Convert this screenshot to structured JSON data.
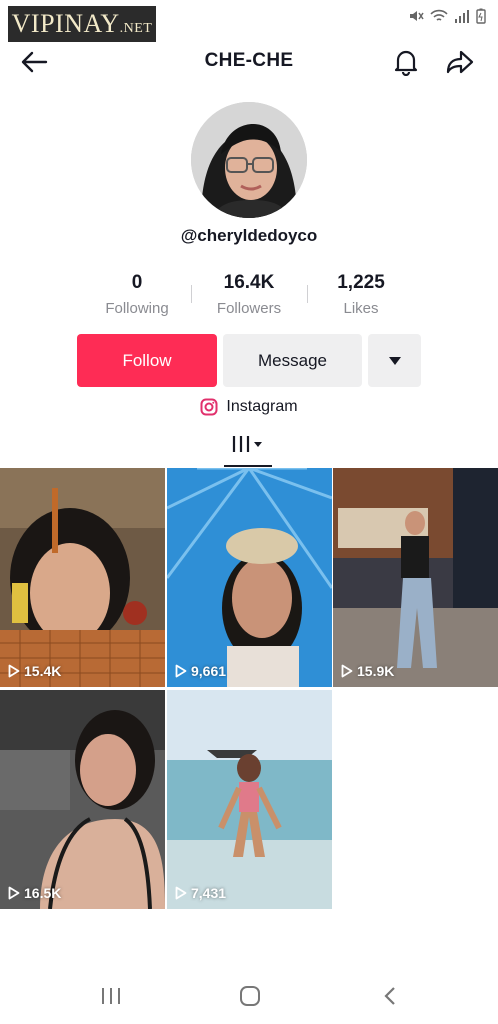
{
  "watermark": {
    "main": "VIPINAY",
    "suffix": ".NET"
  },
  "header": {
    "title": "CHE-CHE",
    "back_icon": "back-arrow-icon",
    "bell_icon": "bell-icon",
    "share_icon": "share-icon"
  },
  "profile": {
    "username": "@cheryldedoyco"
  },
  "stats": [
    {
      "value": "0",
      "label": "Following"
    },
    {
      "value": "16.4K",
      "label": "Followers"
    },
    {
      "value": "1,225",
      "label": "Likes"
    }
  ],
  "actions": {
    "follow": "Follow",
    "message": "Message"
  },
  "link": {
    "label": "Instagram"
  },
  "videos": [
    {
      "views": "15.4K"
    },
    {
      "views": "9,661"
    },
    {
      "views": "15.9K"
    },
    {
      "views": "16.5K"
    },
    {
      "views": "7,431"
    }
  ],
  "colors": {
    "follow": "#fe2c55",
    "text": "#161823",
    "muted": "#8a8b91",
    "secondary_btn": "#efeff0"
  }
}
